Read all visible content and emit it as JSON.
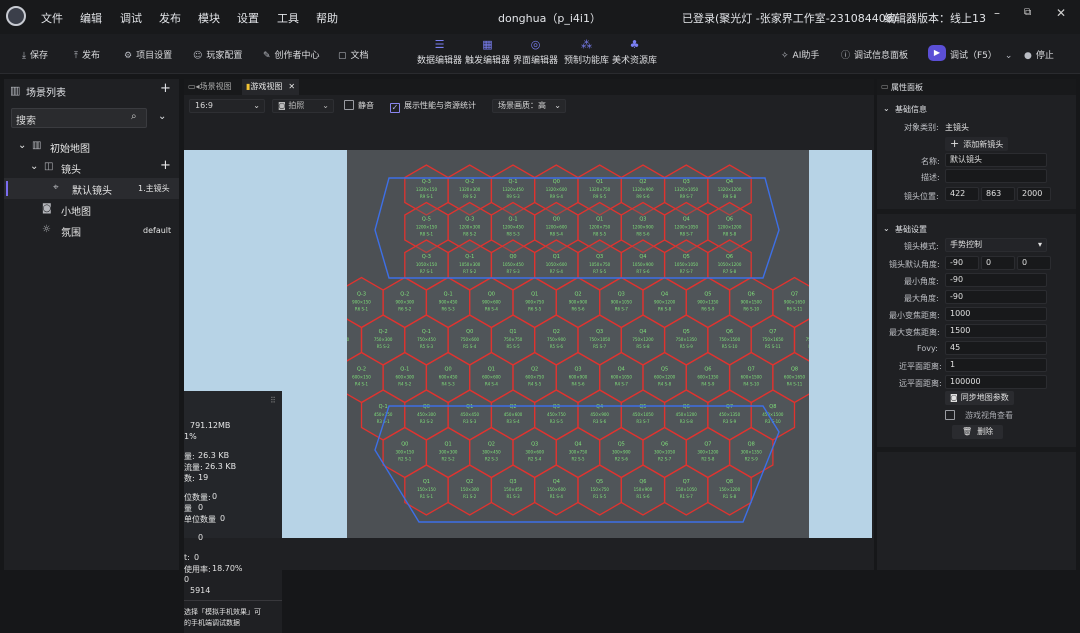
{
  "menubar": {
    "items": [
      "文件",
      "编辑",
      "调试",
      "发布",
      "模块",
      "设置",
      "工具",
      "帮助"
    ],
    "title": "donghua（p_i4i1）",
    "login": "已登录(聚光灯 -张家界工作室-231084408)",
    "version": "编辑器版本：线上13",
    "minimize": "–",
    "maximize": "⧉",
    "close": "✕"
  },
  "toolbar": {
    "save": "保存",
    "publish": "发布",
    "project_settings": "项目设置",
    "player_config": "玩家配置",
    "creator_center": "创作者中心",
    "docs": "文档",
    "center_tools": [
      "数据编辑器",
      "触发编辑器",
      "界面编辑器",
      "预制功能库",
      "美术资源库"
    ],
    "ai": "AI助手",
    "debug_panel": "调试信息面板",
    "run": "调试（F5）",
    "stop": "停止",
    "run_icon": "▶"
  },
  "left": {
    "title": "场景列表",
    "add": "+",
    "search_placeholder": "搜索",
    "tree": {
      "root": "初始地图",
      "camera_group": "镜头",
      "camera_add": "+",
      "default_camera": "默认镜头",
      "default_camera_tag": "1.主镜头",
      "minimap": "小地图",
      "atmosphere": "氛围",
      "atmosphere_value": "default"
    }
  },
  "center": {
    "tabs": [
      "场景视图",
      "游戏视图"
    ],
    "tab_close": "✕",
    "ratio": "16:9",
    "photo": "拍照",
    "mute": "静音",
    "show_stats": "展示性能与资源统计",
    "quality_label": "场景画质：",
    "quality_value": "高",
    "stats": {
      "memory": "791.12MB",
      "percent": "1%",
      "line1_label": "量:",
      "line1_value": "26.3 KB",
      "line2_label": "流量:",
      "line2_value": "26.3 KB",
      "line3_label": "数:",
      "line3_value": "19",
      "line4_label": "位数量:",
      "line4_value": "0",
      "line5_label": "量",
      "line5_value": "0",
      "line6_label": "单位数量",
      "line6_value": "0",
      "line7_value": "0",
      "line8_label": "t:",
      "line8_value": "0",
      "line9_label": "使用率:",
      "line9_value": "18.70%",
      "line10_value": "0",
      "line11_value": "5914",
      "hint1": "选择「模拟手机效果」可",
      "hint2": "的手机端调试数据"
    },
    "hex_rows": [
      {
        "labels": [
          "Q-3",
          "Q-2",
          "Q-1",
          "Q0",
          "Q1",
          "Q2",
          "Q3",
          "Q4"
        ],
        "coord_row": "R9",
        "pos_y": "1320"
      },
      {
        "labels": [
          "Q-5",
          "Q-3",
          "Q-1",
          "Q0",
          "Q1",
          "Q3",
          "Q4",
          "Q6"
        ],
        "coord_row": "R8",
        "pos_y": "1200"
      },
      {
        "labels": [
          "Q-3",
          "Q-1",
          "Q0",
          "Q1",
          "Q3",
          "Q4",
          "Q5",
          "Q6"
        ],
        "coord_row": "R7",
        "pos_y": "1050"
      },
      {
        "labels": [
          "Q-3",
          "Q-2",
          "Q-1",
          "Q0",
          "Q1",
          "Q2",
          "Q3",
          "Q4",
          "Q5",
          "Q6",
          "Q7"
        ],
        "coord_row": "R6",
        "pos_y": "900"
      },
      {
        "labels": [
          "Q-3",
          "Q-2",
          "Q-1",
          "Q0",
          "Q1",
          "Q2",
          "Q3",
          "Q4",
          "Q5",
          "Q6",
          "Q7",
          "Q8"
        ],
        "coord_row": "R5",
        "pos_y": "750"
      },
      {
        "labels": [
          "Q-2",
          "Q-1",
          "Q0",
          "Q1",
          "Q2",
          "Q3",
          "Q4",
          "Q5",
          "Q6",
          "Q7",
          "Q8"
        ],
        "coord_row": "R4",
        "pos_y": "600"
      },
      {
        "labels": [
          "Q-1",
          "Q0",
          "Q1",
          "Q2",
          "Q3",
          "Q4",
          "Q5",
          "Q6",
          "Q7",
          "Q8"
        ],
        "coord_row": "R3",
        "pos_y": "450"
      },
      {
        "labels": [
          "Q0",
          "Q1",
          "Q2",
          "Q3",
          "Q4",
          "Q5",
          "Q6",
          "Q7",
          "Q8"
        ],
        "coord_row": "R2",
        "pos_y": "300"
      },
      {
        "labels": [
          "Q1",
          "Q2",
          "Q3",
          "Q4",
          "Q5",
          "Q6",
          "Q7",
          "Q8"
        ],
        "coord_row": "R1",
        "pos_y": "150"
      }
    ]
  },
  "right": {
    "title": "属性面板",
    "basic_info": "基础信息",
    "object_type_label": "对象类别:",
    "object_type": "主镜头",
    "add_camera": "添加新镜头",
    "name_label": "名称:",
    "name": "默认镜头",
    "desc_label": "描述:",
    "pos_label": "镜头位置:",
    "pos": [
      "422",
      "863",
      "2000"
    ],
    "basic_settings": "基础设置",
    "mode_label": "镜头模式:",
    "mode": "手势控制",
    "default_angle_label": "镜头默认角度:",
    "default_angle": [
      "-90",
      "0",
      "0"
    ],
    "min_angle_label": "最小角度:",
    "min_angle": "-90",
    "max_angle_label": "最大角度:",
    "max_angle": "-90",
    "min_focus_label": "最小变焦距离:",
    "min_focus": "1000",
    "max_focus_label": "最大变焦距离:",
    "max_focus": "1500",
    "fovy_label": "Fovy:",
    "fovy": "45",
    "near_label": "近平面距离:",
    "near": "1",
    "far_label": "远平面距离:",
    "far": "100000",
    "sync_btn": "同步地图参数",
    "game_view_label": "游戏视角查看",
    "delete_btn": "删除"
  }
}
